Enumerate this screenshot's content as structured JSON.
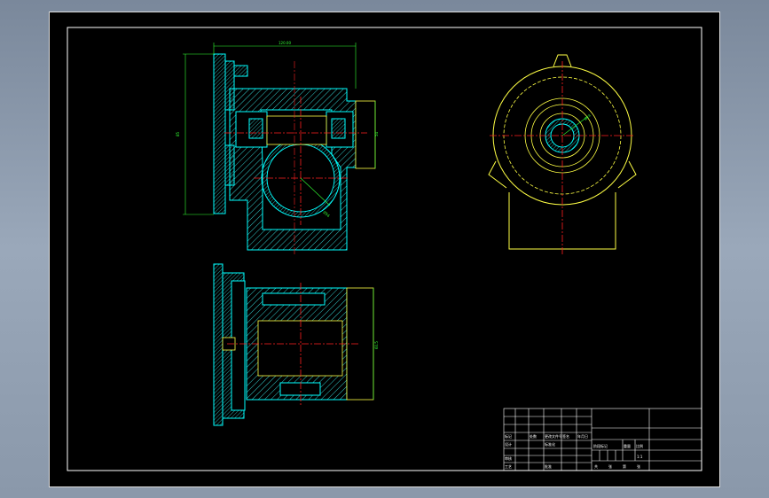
{
  "drawing": {
    "colors": {
      "background": "#000000",
      "outline": "#00ffff",
      "hatch": "#00ffff",
      "center_line": "#ff2020",
      "dimension": "#33ff33",
      "edge": "#ffff44",
      "frame": "#ffffff",
      "title_magenta": "#ff33ff"
    },
    "views": [
      "front-section",
      "top-section",
      "side-view"
    ],
    "dimension_labels": {
      "width_top": "120.00",
      "height_left": "85",
      "height_right": "54",
      "bore_dia": "Ø56",
      "height_bottom_right": "60.5",
      "hole_dia": "Ø24"
    }
  },
  "title_block": {
    "rows_left": [
      [
        "",
        "",
        "",
        "",
        "",
        ""
      ],
      [
        "",
        "",
        "",
        "",
        "",
        ""
      ],
      [
        "",
        "",
        "",
        "",
        "",
        ""
      ],
      [
        "标记",
        "处数",
        "分区",
        "更改文件号",
        "签名",
        "年月日"
      ],
      [
        "设计",
        "",
        "",
        "标准化",
        "",
        ""
      ],
      [
        "",
        "",
        "",
        "",
        "",
        ""
      ],
      [
        "审核",
        "",
        "",
        "",
        "",
        ""
      ],
      [
        "工艺",
        "",
        "",
        "批准",
        "",
        ""
      ]
    ],
    "middle_labels": [
      "阶段标记",
      "重量",
      "比例"
    ],
    "scale": "1:1",
    "sheet_labels": [
      "共",
      "张",
      "第",
      "张"
    ]
  }
}
